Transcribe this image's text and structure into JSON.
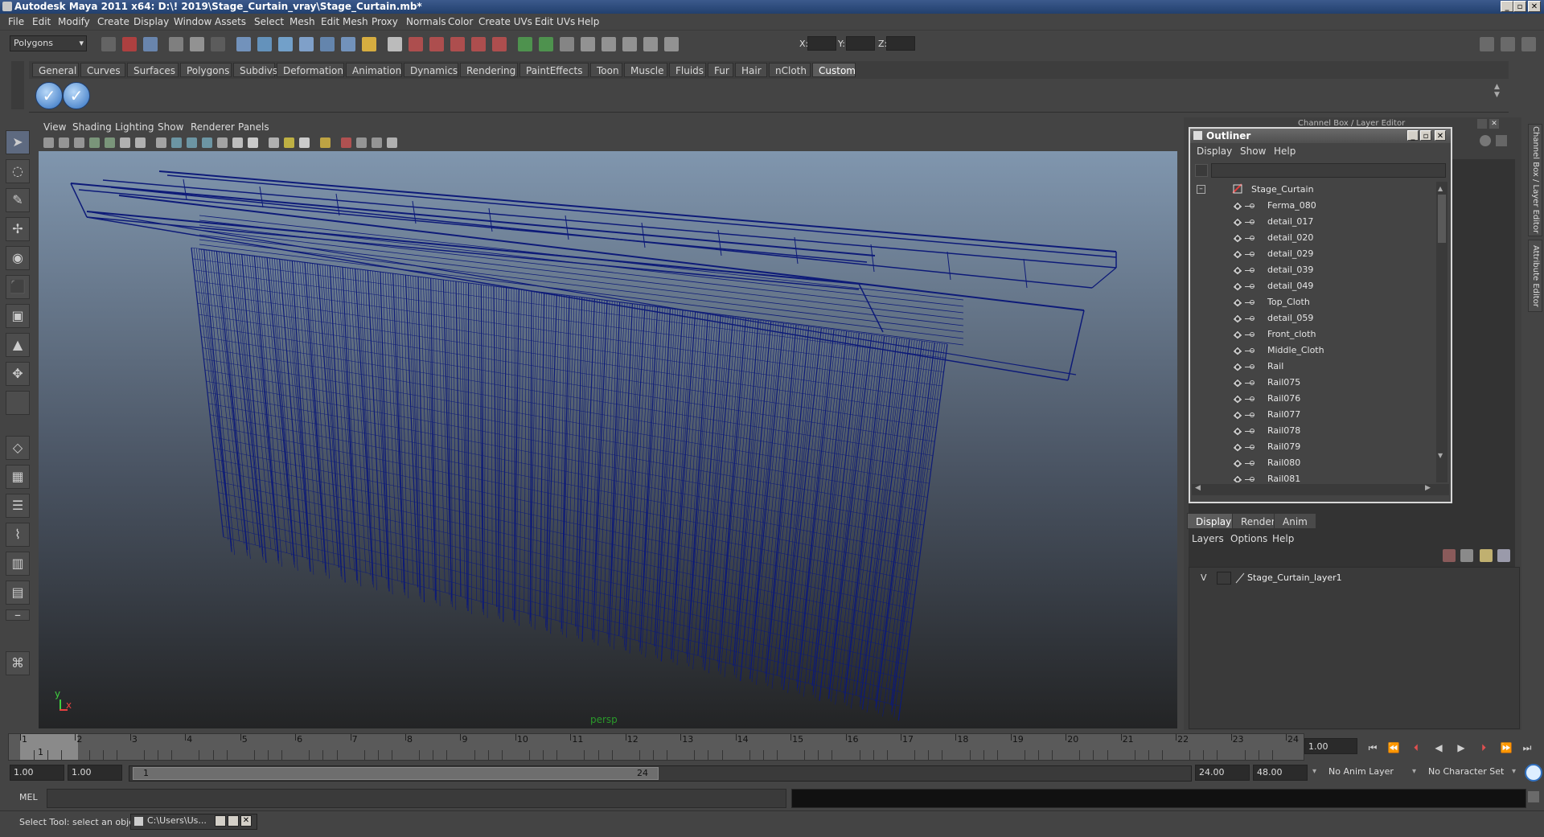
{
  "window": {
    "title": "Autodesk Maya 2011 x64: D:\\! 2019\\Stage_Curtain_vray\\Stage_Curtain.mb*"
  },
  "menubar": [
    "File",
    "Edit",
    "Modify",
    "Create",
    "Display",
    "Window",
    "Assets",
    "Select",
    "Mesh",
    "Edit Mesh",
    "Proxy",
    "Normals",
    "Color",
    "Create UVs",
    "Edit UVs",
    "Help"
  ],
  "statusline": {
    "menu_set": "Polygons",
    "x_label": "X:",
    "y_label": "Y:",
    "z_label": "Z:"
  },
  "shelf": {
    "tabs": [
      "General",
      "Curves",
      "Surfaces",
      "Polygons",
      "Subdivs",
      "Deformation",
      "Animation",
      "Dynamics",
      "Rendering",
      "PaintEffects",
      "Toon",
      "Muscle",
      "Fluids",
      "Fur",
      "Hair",
      "nCloth",
      "Custom"
    ],
    "active_tab": "Custom"
  },
  "viewport": {
    "menu": [
      "View",
      "Shading",
      "Lighting",
      "Show",
      "Renderer",
      "Panels"
    ],
    "camera_label": "persp",
    "axis_y": "y",
    "axis_x": "x",
    "wire_color": "#0d1a78"
  },
  "outliner": {
    "title": "Outliner",
    "menu": [
      "Display",
      "Show",
      "Help"
    ],
    "root": "Stage_Curtain",
    "items": [
      "Ferma_080",
      "detail_017",
      "detail_020",
      "detail_029",
      "detail_039",
      "detail_049",
      "Top_Cloth",
      "detail_059",
      "Front_cloth",
      "Middle_Cloth",
      "Rail",
      "Rail075",
      "Rail076",
      "Rail077",
      "Rail078",
      "Rail079",
      "Rail080",
      "Rail081"
    ]
  },
  "channelbox": {
    "title": "Channel Box / Layer Editor"
  },
  "sidetabs": [
    "Channel Box / Layer Editor",
    "Attribute Editor"
  ],
  "layer_editor": {
    "tabs": [
      "Display",
      "Render",
      "Anim"
    ],
    "active_tab": "Display",
    "menu": [
      "Layers",
      "Options",
      "Help"
    ],
    "layers": [
      {
        "visible": "V",
        "name": "Stage_Curtain_layer1"
      }
    ]
  },
  "timeslider": {
    "ticks": [
      "1",
      "2",
      "3",
      "4",
      "5",
      "6",
      "7",
      "8",
      "9",
      "10",
      "11",
      "12",
      "13",
      "14",
      "15",
      "16",
      "17",
      "18",
      "19",
      "20",
      "21",
      "22",
      "23",
      "24"
    ],
    "current_frame": "1.00",
    "current_marker": "1"
  },
  "range": {
    "start": "1.00",
    "playback_start": "1.00",
    "slider_start": "1",
    "slider_end": "24",
    "playback_end": "24.00",
    "end": "48.00",
    "anim_layer": "No Anim Layer",
    "character_set": "No Character Set"
  },
  "cmdline": {
    "label": "MEL"
  },
  "helpline": {
    "text": "Select Tool: select an object",
    "task": "C:\\Users\\Us..."
  }
}
